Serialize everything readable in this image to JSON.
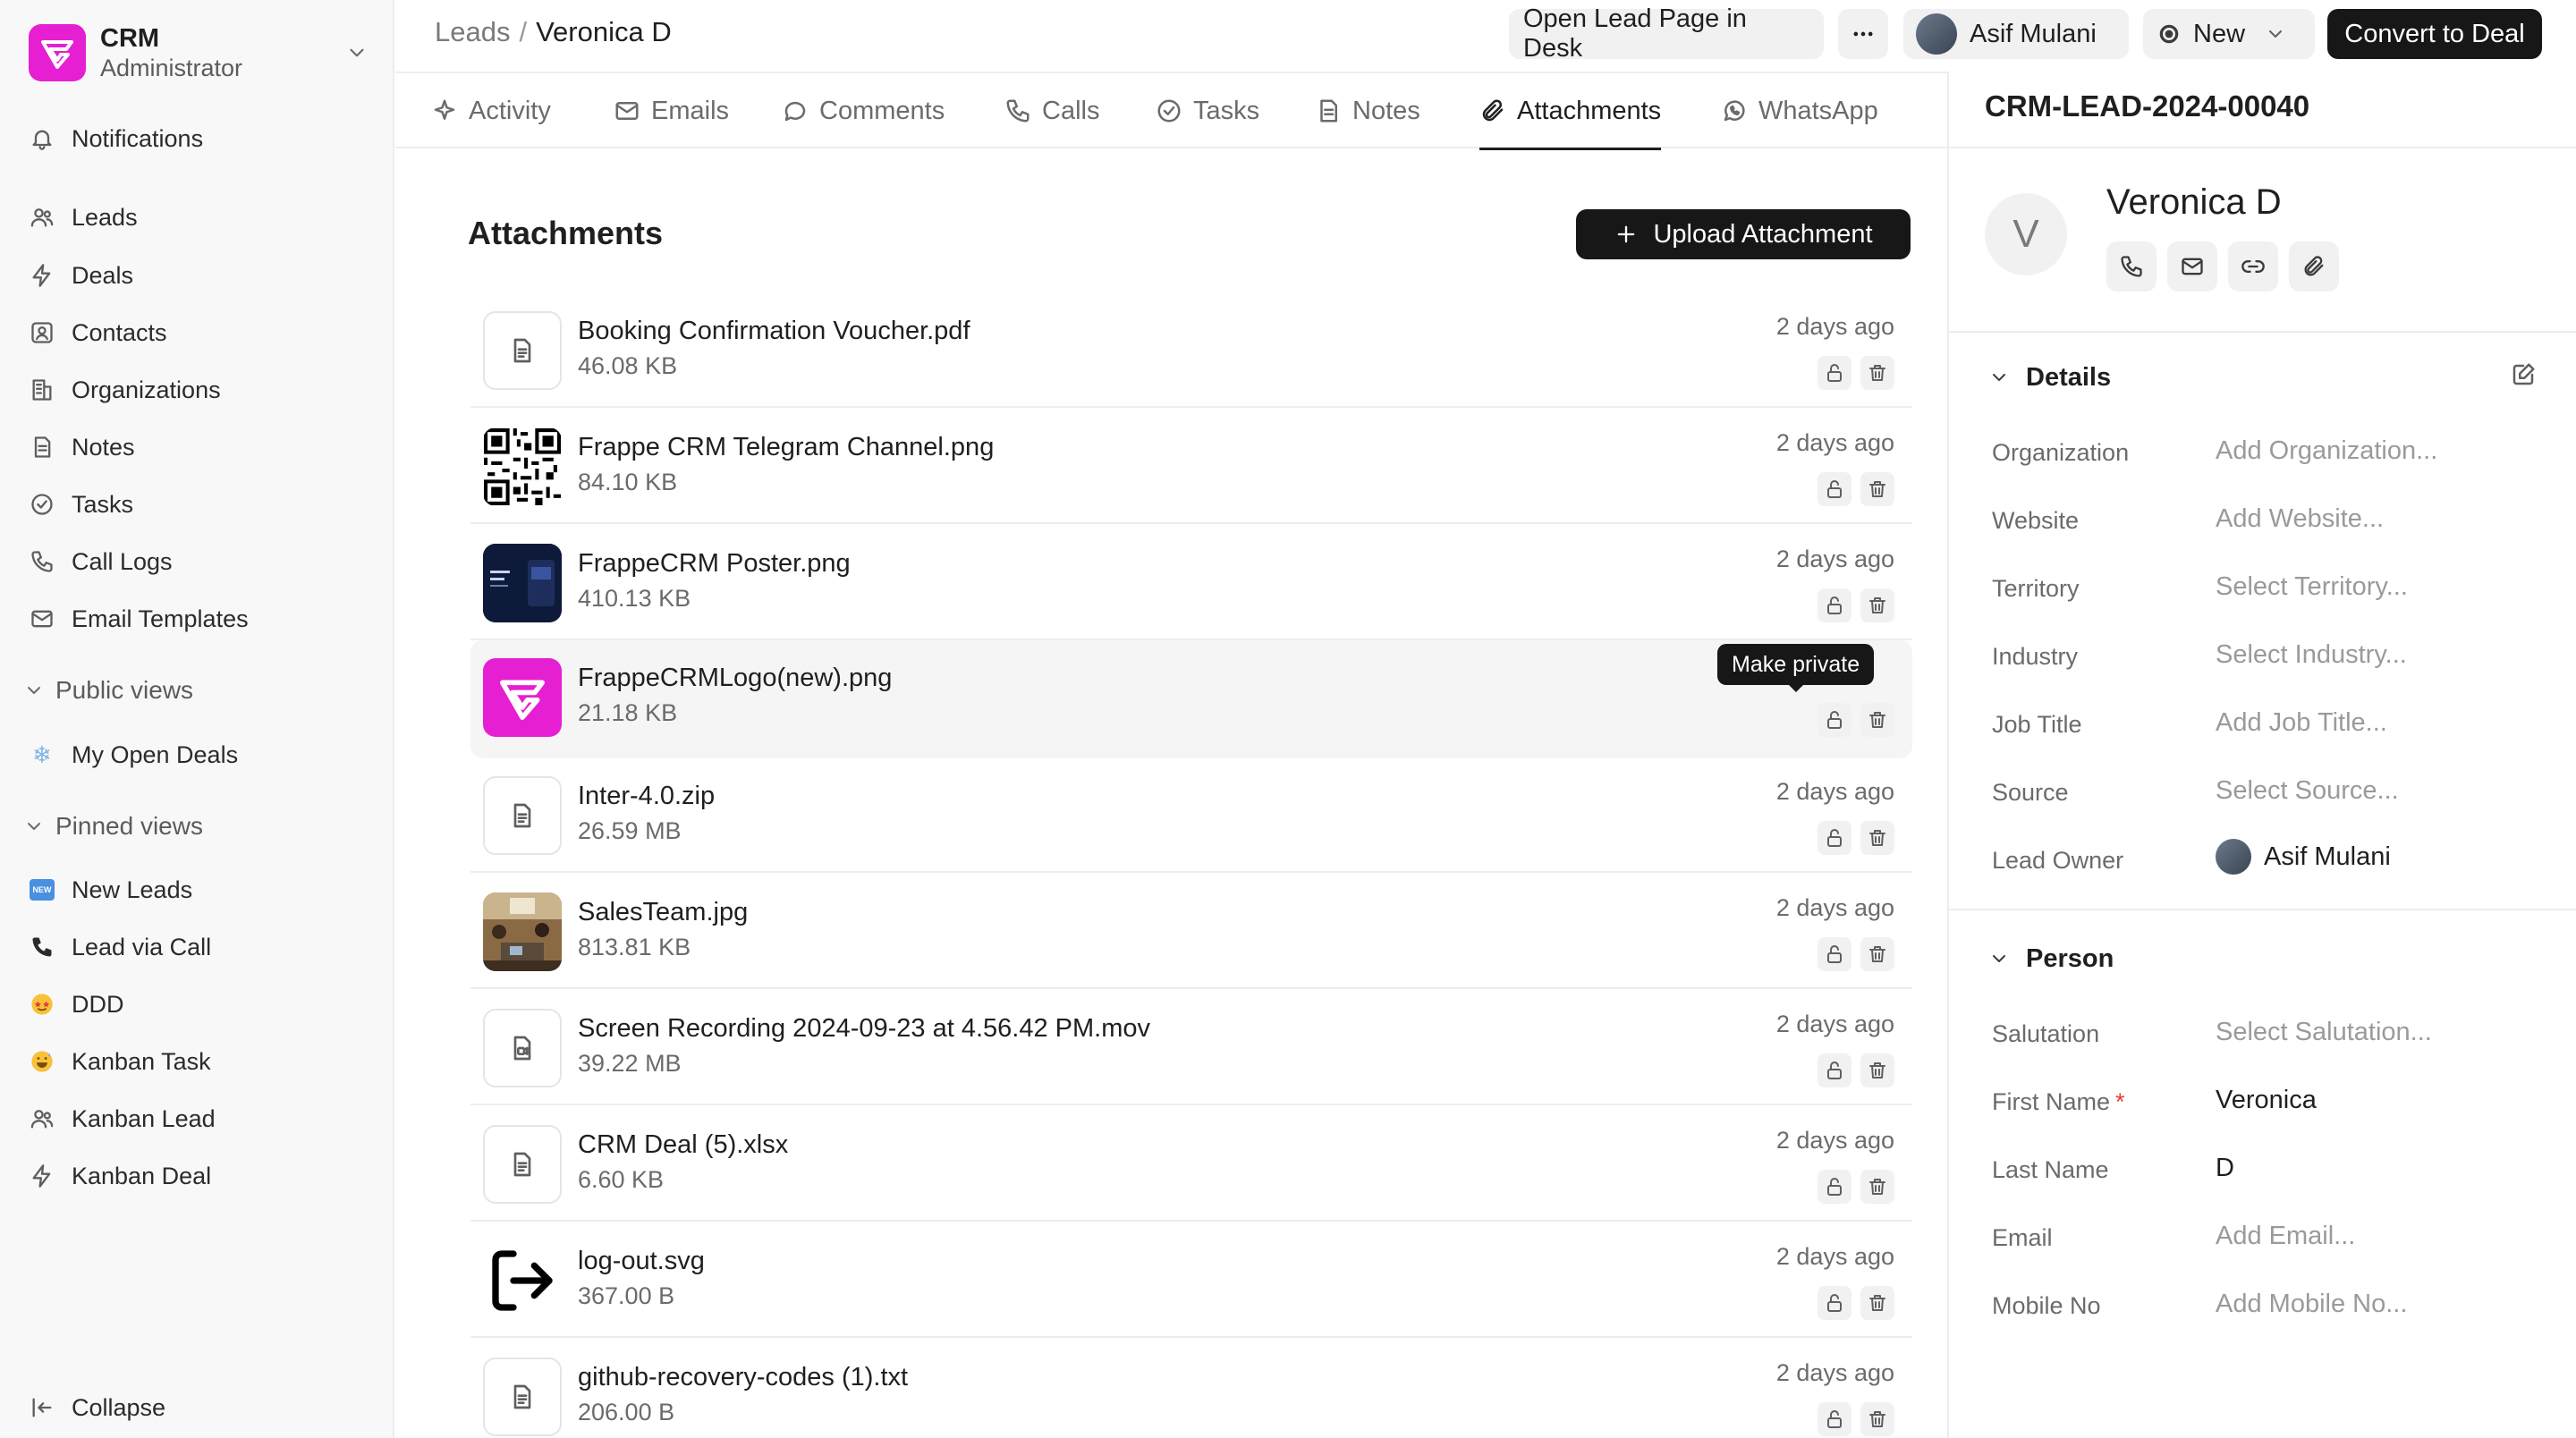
{
  "app": {
    "name": "CRM",
    "role": "Administrator",
    "brand_color": "#e61fd2"
  },
  "sidebar": {
    "notifications": "Notifications",
    "items": [
      {
        "label": "Leads",
        "icon": "users-icon"
      },
      {
        "label": "Deals",
        "icon": "bolt-icon"
      },
      {
        "label": "Contacts",
        "icon": "contact-icon"
      },
      {
        "label": "Organizations",
        "icon": "building-icon"
      },
      {
        "label": "Notes",
        "icon": "note-icon"
      },
      {
        "label": "Tasks",
        "icon": "check-circle-icon"
      },
      {
        "label": "Call Logs",
        "icon": "phone-icon"
      },
      {
        "label": "Email Templates",
        "icon": "mail-icon"
      }
    ],
    "public_views_label": "Public views",
    "public_views": [
      {
        "label": "My Open Deals",
        "icon": "snowflake-emoji"
      }
    ],
    "pinned_views_label": "Pinned views",
    "pinned_views": [
      {
        "label": "New Leads",
        "icon": "new-emoji"
      },
      {
        "label": "Lead via Call",
        "icon": "telephone-emoji"
      },
      {
        "label": "DDD",
        "icon": "star-struck-emoji"
      },
      {
        "label": "Kanban Task",
        "icon": "grinning-sweat-emoji"
      },
      {
        "label": "Kanban Lead",
        "icon": "users-icon"
      },
      {
        "label": "Kanban Deal",
        "icon": "bolt-icon"
      }
    ],
    "collapse": "Collapse"
  },
  "header": {
    "breadcrumb_root": "Leads",
    "breadcrumb_sep": "/",
    "breadcrumb_current": "Veronica D",
    "open_desk": "Open Lead Page in Desk",
    "user": "Asif Mulani",
    "status": "New",
    "convert": "Convert to Deal"
  },
  "tabs": [
    {
      "label": "Activity",
      "icon": "activity-icon"
    },
    {
      "label": "Emails",
      "icon": "mail-icon"
    },
    {
      "label": "Comments",
      "icon": "comment-icon"
    },
    {
      "label": "Calls",
      "icon": "phone-icon"
    },
    {
      "label": "Tasks",
      "icon": "check-circle-icon"
    },
    {
      "label": "Notes",
      "icon": "note-icon"
    },
    {
      "label": "Attachments",
      "icon": "paperclip-icon",
      "active": true
    },
    {
      "label": "WhatsApp",
      "icon": "whatsapp-icon"
    }
  ],
  "attachments": {
    "title": "Attachments",
    "upload_label": "Upload Attachment",
    "tooltip": "Make private",
    "files": [
      {
        "name": "Booking Confirmation Voucher.pdf",
        "size": "46.08 KB",
        "date": "2 days ago",
        "thumb": "file-icon"
      },
      {
        "name": "Frappe CRM Telegram Channel.png",
        "size": "84.10 KB",
        "date": "2 days ago",
        "thumb": "qr-image"
      },
      {
        "name": "FrappeCRM Poster.png",
        "size": "410.13 KB",
        "date": "2 days ago",
        "thumb": "poster-image"
      },
      {
        "name": "FrappeCRMLogo(new).png",
        "size": "21.18 KB",
        "date": "",
        "thumb": "logo-image"
      },
      {
        "name": "Inter-4.0.zip",
        "size": "26.59 MB",
        "date": "2 days ago",
        "thumb": "file-icon"
      },
      {
        "name": "SalesTeam.jpg",
        "size": "813.81 KB",
        "date": "2 days ago",
        "thumb": "photo-image"
      },
      {
        "name": "Screen Recording 2024-09-23 at 4.56.42 PM.mov",
        "size": "39.22 MB",
        "date": "2 days ago",
        "thumb": "video-file-icon"
      },
      {
        "name": "CRM Deal (5).xlsx",
        "size": "6.60 KB",
        "date": "2 days ago",
        "thumb": "file-icon"
      },
      {
        "name": "log-out.svg",
        "size": "367.00 B",
        "date": "2 days ago",
        "thumb": "logout-image"
      },
      {
        "name": "github-recovery-codes (1).txt",
        "size": "206.00 B",
        "date": "2 days ago",
        "thumb": "file-icon"
      }
    ]
  },
  "panel": {
    "lead_id": "CRM-LEAD-2024-00040",
    "avatar_letter": "V",
    "name": "Veronica D",
    "details_title": "Details",
    "details": [
      {
        "label": "Organization",
        "value": "Add Organization..."
      },
      {
        "label": "Website",
        "value": "Add Website..."
      },
      {
        "label": "Territory",
        "value": "Select Territory..."
      },
      {
        "label": "Industry",
        "value": "Select Industry..."
      },
      {
        "label": "Job Title",
        "value": "Add Job Title..."
      },
      {
        "label": "Source",
        "value": "Select Source..."
      },
      {
        "label": "Lead Owner",
        "value": "Asif Mulani"
      }
    ],
    "person_title": "Person",
    "person": [
      {
        "label": "Salutation",
        "value": "Select Salutation..."
      },
      {
        "label": "First Name",
        "value": "Veronica",
        "required": "*"
      },
      {
        "label": "Last Name",
        "value": "D"
      },
      {
        "label": "Email",
        "value": "Add Email..."
      },
      {
        "label": "Mobile No",
        "value": "Add Mobile No..."
      }
    ]
  }
}
